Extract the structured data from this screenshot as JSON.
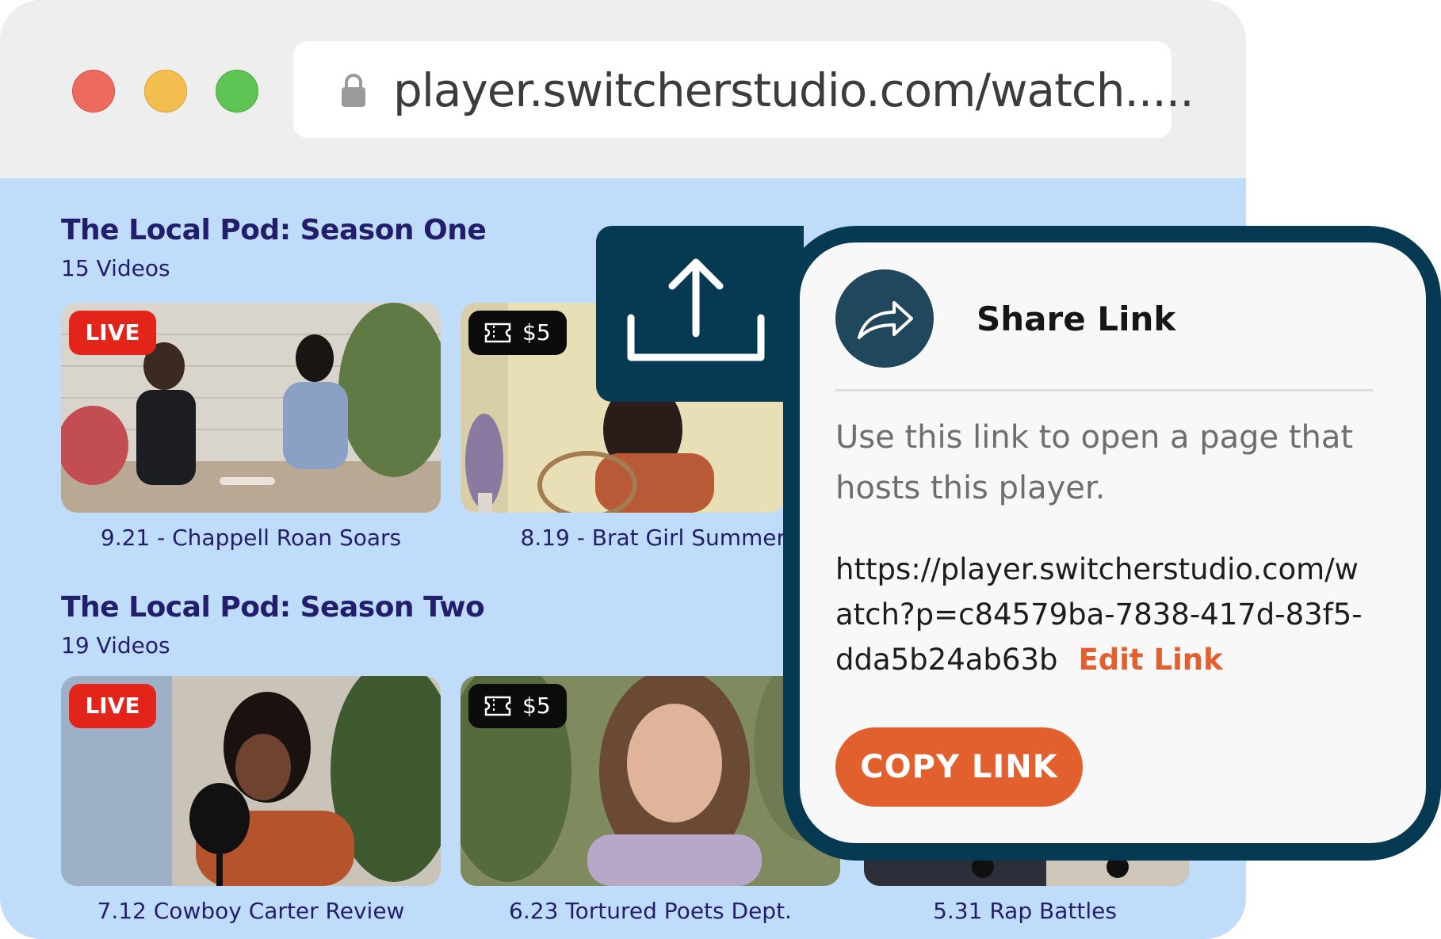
{
  "browser": {
    "url": "player.switcherstudio.com/watch.....",
    "lock_icon": "lock-icon"
  },
  "sections": [
    {
      "title": "The Local Pod: Season One",
      "count": "15 Videos",
      "videos": [
        {
          "badge": "LIVE",
          "caption": "9.21 - Chappell Roan Soars"
        },
        {
          "badge": "$5",
          "caption": "8.19 - Brat Girl Summer"
        }
      ]
    },
    {
      "title": "The Local Pod: Season Two",
      "count": "19 Videos",
      "videos": [
        {
          "badge": "LIVE",
          "caption": "7.12 Cowboy Carter Review"
        },
        {
          "badge": "$5",
          "caption": "6.23 Tortured Poets Dept."
        },
        {
          "caption": "5.31 Rap Battles"
        }
      ]
    }
  ],
  "share_panel": {
    "title": "Share Link",
    "description": "Use this link to open a page that hosts this player.",
    "link": "https://player.switcherstudio.com/watch?p=c84579ba-7838-417d-83f5-dda5b24ab63b",
    "edit_label": "Edit Link",
    "copy_label": "COPY LINK"
  },
  "colors": {
    "accent_orange": "#e2602e",
    "navy": "#063a52",
    "title_purple": "#221e6b",
    "live_red": "#e3241b",
    "page_bg": "#c0dcfb"
  }
}
